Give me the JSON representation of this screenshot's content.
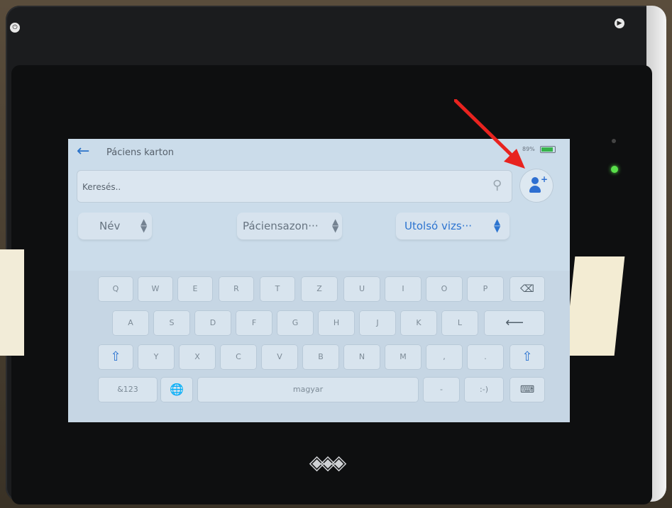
{
  "app": {
    "title": "Páciens karton",
    "battery": "89%"
  },
  "search": {
    "placeholder": "Keresés.."
  },
  "sort_buttons": [
    {
      "label": "Név"
    },
    {
      "label": "Páciensazon···"
    },
    {
      "label": "Utolsó vizs···"
    }
  ],
  "keyboard": {
    "row1": [
      "Q",
      "W",
      "E",
      "R",
      "T",
      "Z",
      "U",
      "I",
      "O",
      "P"
    ],
    "row2": [
      "A",
      "S",
      "D",
      "F",
      "G",
      "H",
      "J",
      "K",
      "L"
    ],
    "row3": [
      "Y",
      "X",
      "C",
      "V",
      "B",
      "N",
      "M",
      ",",
      "."
    ],
    "row4": {
      "symbols": "&123",
      "space": "magyar",
      "dash": "-",
      "smiley": ":-)"
    }
  },
  "device": {
    "logo": "◈◈◈"
  },
  "colors": {
    "accent": "#2c74d0",
    "arrow": "#e8231f",
    "led": "#59e04a"
  },
  "icons": {
    "back": "arrow-left-icon",
    "search": "search-icon",
    "add_user": "add-user-icon",
    "backspace": "backspace-icon",
    "enter": "enter-icon",
    "shift": "shift-icon",
    "globe": "globe-icon",
    "keyboard_hide": "keyboard-hide-icon"
  }
}
